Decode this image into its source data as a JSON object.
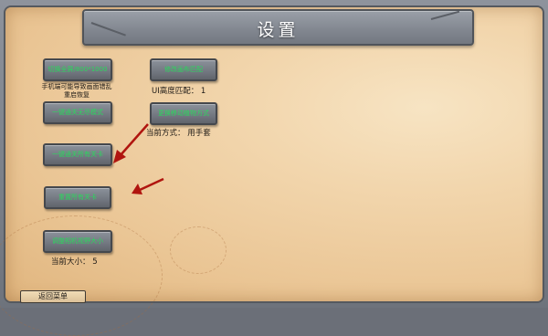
{
  "title": "设置",
  "buttons": {
    "switch_resolution": "切换全屏/800*1000",
    "change_canvas": "修改画布匹配",
    "one_key_pass_endless": "一键通关无尽模式",
    "change_drag": "更换移动植物方式",
    "one_key_pass_all": "一键通关所有关卡",
    "reset_all": "重置所有关卡",
    "adjust_camera": "调整相机视野大小"
  },
  "notes": {
    "phone_warning": "手机端可能导致画面错乱\n重启恢复",
    "ui_height_match": "UI高度匹配： 1",
    "current_mode": "当前方式： 用手套",
    "current_size": "当前大小： 5"
  },
  "back_label": "返回菜单",
  "colors": {
    "button_text": "#29d85c",
    "arrow": "#b0150f",
    "stone": "#7b8089",
    "parchment": "#f2d6ad"
  }
}
